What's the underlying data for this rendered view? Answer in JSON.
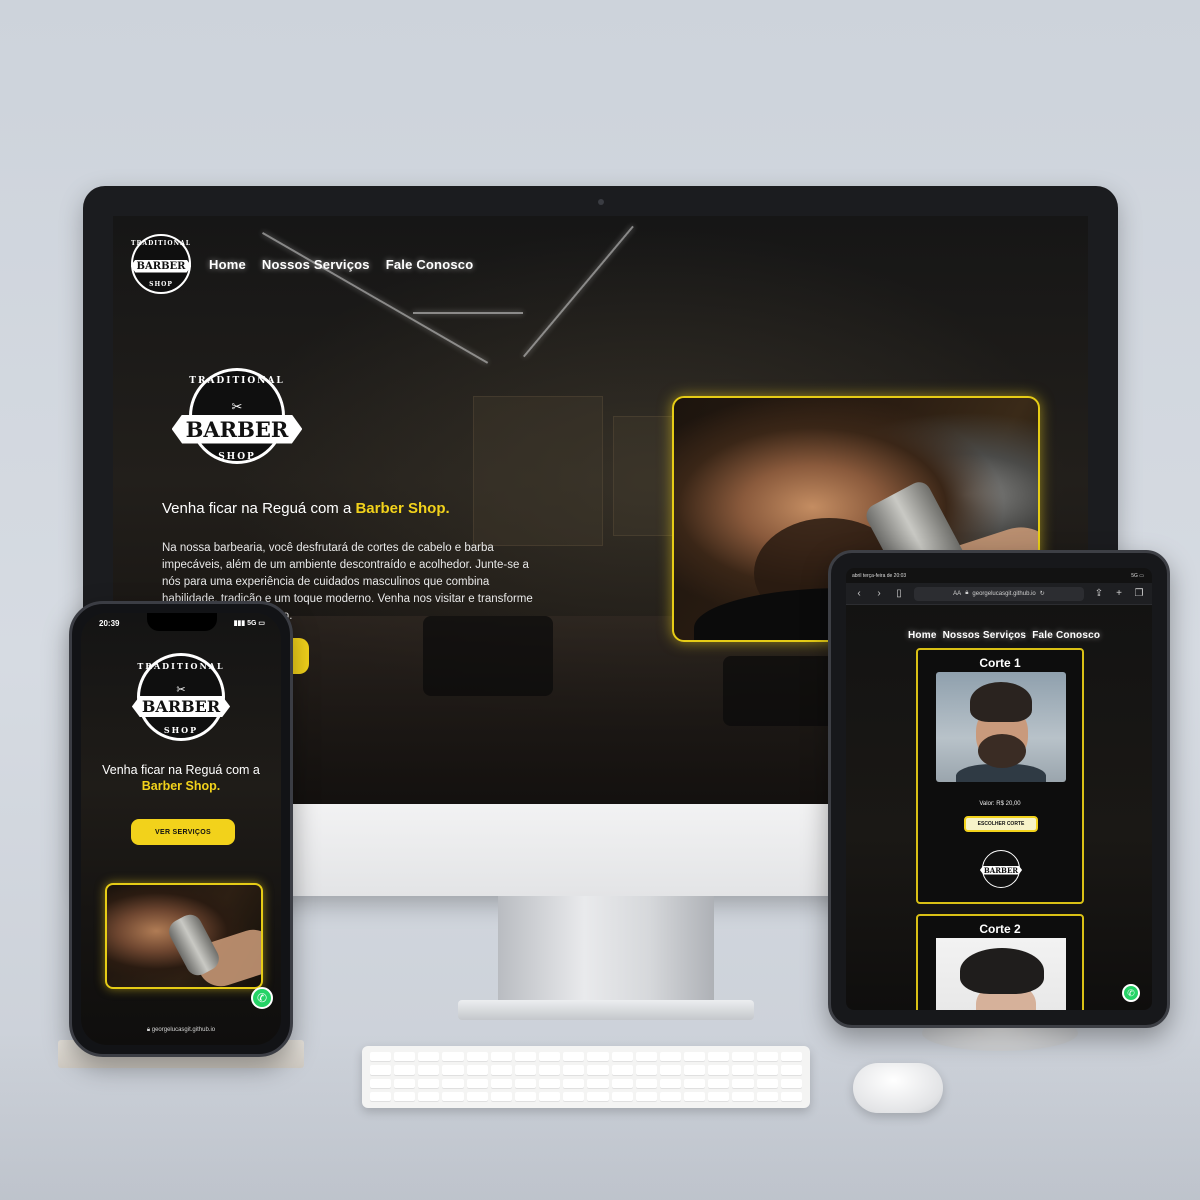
{
  "site": {
    "nav": [
      "Home",
      "Nossos Serviços",
      "Fale Conosco"
    ],
    "logo": {
      "top": "TRADITIONAL",
      "middle": "BARBER",
      "bottom": "SHOP"
    },
    "tagline_prefix": "Venha ficar na Reguá com a",
    "tagline_accent": "Barber Shop.",
    "description": "Na nossa barbearia, você desfrutará de cortes de cabelo e barba impecáveis, além de um ambiente descontraído e acolhedor. Junte-se a nós para uma experiência de cuidados masculinos que combina habilidade, tradição e um toque moderno. Venha nos visitar e transforme sua aparência com estilo.",
    "cta_label": "VER SERVIÇOS",
    "accent_color": "#f2d21b"
  },
  "phone": {
    "time": "20:39",
    "network": "5G",
    "url": "georgelucasgit.github.io"
  },
  "tablet": {
    "status_left": "abril terça-feira de 20:03",
    "status_right": "5G",
    "address": "georgelucasgit.github.io",
    "text_size_label": "AA",
    "cards": [
      {
        "title": "Corte 1",
        "price": "Valor: R$ 20,00",
        "button": "ESCOLHER CORTE"
      },
      {
        "title": "Corte 2"
      }
    ]
  },
  "icons": {
    "whatsapp": "whatsapp-icon",
    "back": "chevron-left-icon",
    "forward": "chevron-right-icon",
    "share": "share-icon",
    "add": "plus-icon",
    "tabs": "tabs-icon",
    "lock": "lock-icon",
    "reload": "reload-icon",
    "sidebar": "sidebar-icon"
  }
}
